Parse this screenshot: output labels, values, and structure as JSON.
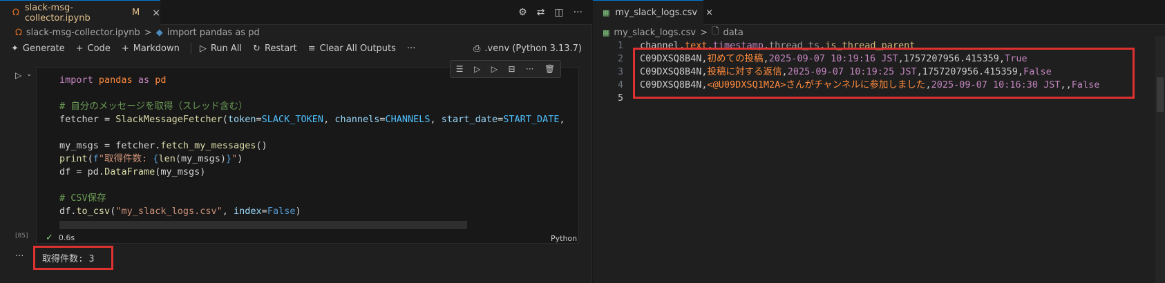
{
  "left": {
    "tab": {
      "filename": "slack-msg-collector.ipynb",
      "modified": "M",
      "close": "×"
    },
    "breadcrumb": {
      "file": "slack-msg-collector.ipynb",
      "separator": ">",
      "cell": "import pandas as pd"
    },
    "toolbar": {
      "generate": "Generate",
      "code": "Code",
      "markdown": "Markdown",
      "run_all": "Run All",
      "restart": "Restart",
      "clear_outputs": "Clear All Outputs",
      "more": "···",
      "kernel": ".venv (Python 3.13.7)"
    },
    "cell": {
      "exec_count": "[85]",
      "duration": "0.6s",
      "language": "Python",
      "lines": [
        [
          {
            "t": "import",
            "c": "kw"
          },
          {
            "t": " pandas ",
            "c": "imp"
          },
          {
            "t": "as",
            "c": "kw"
          },
          {
            "t": " pd",
            "c": "imp"
          }
        ],
        [],
        [
          {
            "t": "# 自分のメッセージを取得（スレッド含む）",
            "c": "cm"
          }
        ],
        [
          {
            "t": "fetcher",
            "c": "plain"
          },
          {
            "t": " = ",
            "c": "op"
          },
          {
            "t": "SlackMessageFetcher",
            "c": "fn"
          },
          {
            "t": "(",
            "c": "op"
          },
          {
            "t": "token",
            "c": "prm"
          },
          {
            "t": "=",
            "c": "op"
          },
          {
            "t": "SLACK_TOKEN",
            "c": "cst"
          },
          {
            "t": ", ",
            "c": "op"
          },
          {
            "t": "channels",
            "c": "prm"
          },
          {
            "t": "=",
            "c": "op"
          },
          {
            "t": "CHANNELS",
            "c": "cst"
          },
          {
            "t": ", ",
            "c": "op"
          },
          {
            "t": "start_date",
            "c": "prm"
          },
          {
            "t": "=",
            "c": "op"
          },
          {
            "t": "START_DATE",
            "c": "cst"
          },
          {
            "t": ",",
            "c": "op"
          }
        ],
        [],
        [
          {
            "t": "my_msgs",
            "c": "plain"
          },
          {
            "t": " = ",
            "c": "op"
          },
          {
            "t": "fetcher",
            "c": "plain"
          },
          {
            "t": ".",
            "c": "op"
          },
          {
            "t": "fetch_my_messages",
            "c": "fn"
          },
          {
            "t": "()",
            "c": "op"
          }
        ],
        [
          {
            "t": "print",
            "c": "fn"
          },
          {
            "t": "(",
            "c": "op"
          },
          {
            "t": "f",
            "c": "bool"
          },
          {
            "t": "\"取得件数: ",
            "c": "str"
          },
          {
            "t": "{",
            "c": "bool"
          },
          {
            "t": "len",
            "c": "fn"
          },
          {
            "t": "(my_msgs)",
            "c": "plain"
          },
          {
            "t": "}",
            "c": "bool"
          },
          {
            "t": "\"",
            "c": "str"
          },
          {
            "t": ")",
            "c": "op"
          }
        ],
        [
          {
            "t": "df",
            "c": "plain"
          },
          {
            "t": " = ",
            "c": "op"
          },
          {
            "t": "pd",
            "c": "plain"
          },
          {
            "t": ".",
            "c": "op"
          },
          {
            "t": "DataFrame",
            "c": "fn"
          },
          {
            "t": "(my_msgs)",
            "c": "plain"
          }
        ],
        [],
        [
          {
            "t": "# CSV保存",
            "c": "cm"
          }
        ],
        [
          {
            "t": "df",
            "c": "plain"
          },
          {
            "t": ".",
            "c": "op"
          },
          {
            "t": "to_csv",
            "c": "fn"
          },
          {
            "t": "(",
            "c": "op"
          },
          {
            "t": "\"my_slack_logs.csv\"",
            "c": "str"
          },
          {
            "t": ", ",
            "c": "op"
          },
          {
            "t": "index",
            "c": "prm"
          },
          {
            "t": "=",
            "c": "op"
          },
          {
            "t": "False",
            "c": "bool"
          },
          {
            "t": ")",
            "c": "op"
          }
        ]
      ]
    },
    "output": {
      "text": "取得件数: 3"
    }
  },
  "right": {
    "tab": {
      "filename": "my_slack_logs.csv",
      "close": "×"
    },
    "breadcrumb": {
      "file": "my_slack_logs.csv",
      "separator": ">",
      "section": "data"
    },
    "line_numbers": [
      "1",
      "2",
      "3",
      "4",
      "5"
    ],
    "header": [
      "channel",
      "text",
      "timestamp",
      "thread_ts",
      "is_thread_parent"
    ],
    "rows": [
      [
        "C09DXSQ8B4N",
        "初めての投稿",
        "2025-09-07 10:19:16 JST",
        "1757207956.415359",
        "True"
      ],
      [
        "C09DXSQ8B4N",
        "投稿に対する返信",
        "2025-09-07 10:19:25 JST",
        "1757207956.415359",
        "False"
      ],
      [
        "C09DXSQ8B4N",
        "<@U09DXSQ1M2A>さんがチャンネルに参加しました",
        "2025-09-07 10:16:30 JST",
        "",
        "False"
      ]
    ]
  }
}
